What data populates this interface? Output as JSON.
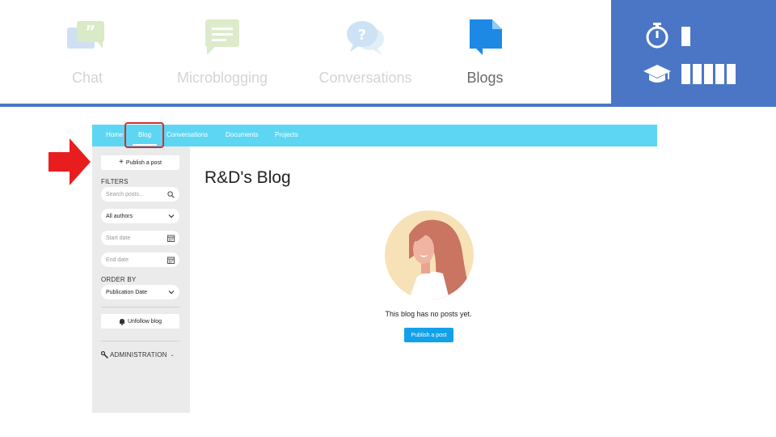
{
  "top_tabs": [
    {
      "label": "Chat",
      "icon": "chat-quote-icon"
    },
    {
      "label": "Microblogging",
      "icon": "microblog-icon"
    },
    {
      "label": "Conversations",
      "icon": "conversation-question-icon"
    },
    {
      "label": "Blogs",
      "icon": "blog-icon"
    }
  ],
  "active_tab": "Blogs",
  "info_panel": {
    "duration_level": 1,
    "difficulty_level": 5,
    "difficulty_max": 5
  },
  "app": {
    "nav": [
      "Home",
      "Blog",
      "Conversations",
      "Documents",
      "Projects"
    ],
    "active_nav": "Blog",
    "sidebar": {
      "publish_button": "Publish a post",
      "filters_label": "FILTERS",
      "search_placeholder": "Search posts...",
      "authors_select": "All authors",
      "start_date_placeholder": "Start date",
      "end_date_placeholder": "End date",
      "order_by_label": "ORDER BY",
      "order_select": "Publication Date",
      "unfollow_button": "Unfollow blog",
      "administration_label": "ADMINISTRATION"
    },
    "main": {
      "title": "R&D's Blog",
      "empty_message": "This blog has no posts yet.",
      "publish_button": "Publish a post"
    }
  },
  "colors": {
    "accent_blue": "#4a76c5",
    "nav_cyan": "#5dd6f3",
    "button_blue": "#12a1e8",
    "pointer_red": "#e81e1e"
  }
}
